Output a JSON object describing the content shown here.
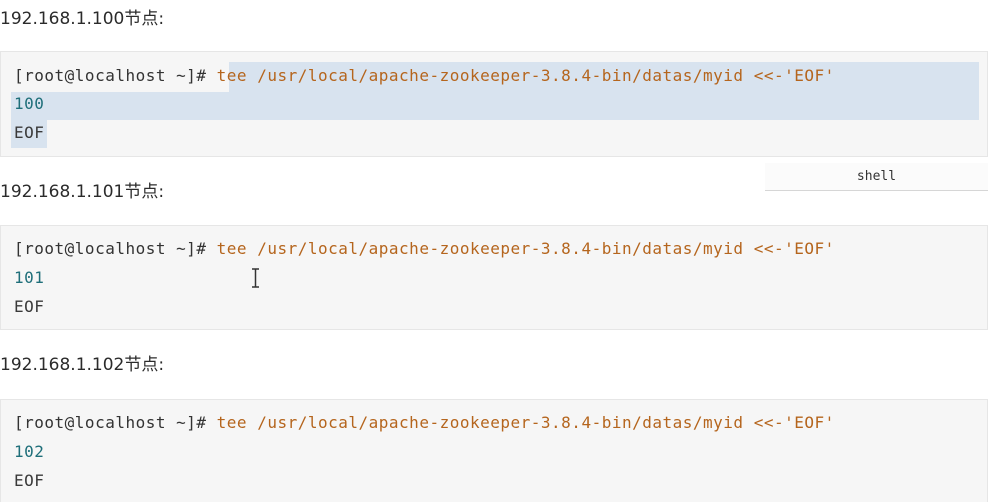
{
  "blocks": [
    {
      "heading": "192.168.1.100节点:",
      "prompt": "[root@localhost ~]# ",
      "command": "tee /usr/local/apache-zookeeper-3.8.4-bin/datas/myid <<-'EOF'",
      "id_value": "100",
      "terminator": "EOF"
    },
    {
      "heading": "192.168.1.101节点:",
      "prompt": "[root@localhost ~]# ",
      "command": "tee /usr/local/apache-zookeeper-3.8.4-bin/datas/myid <<-'EOF'",
      "id_value": "101",
      "terminator": "EOF"
    },
    {
      "heading": "192.168.1.102节点:",
      "prompt": "[root@localhost ~]# ",
      "command": "tee /usr/local/apache-zookeeper-3.8.4-bin/datas/myid <<-'EOF'",
      "id_value": "102",
      "terminator": "EOF"
    }
  ],
  "language_tab": "shell"
}
